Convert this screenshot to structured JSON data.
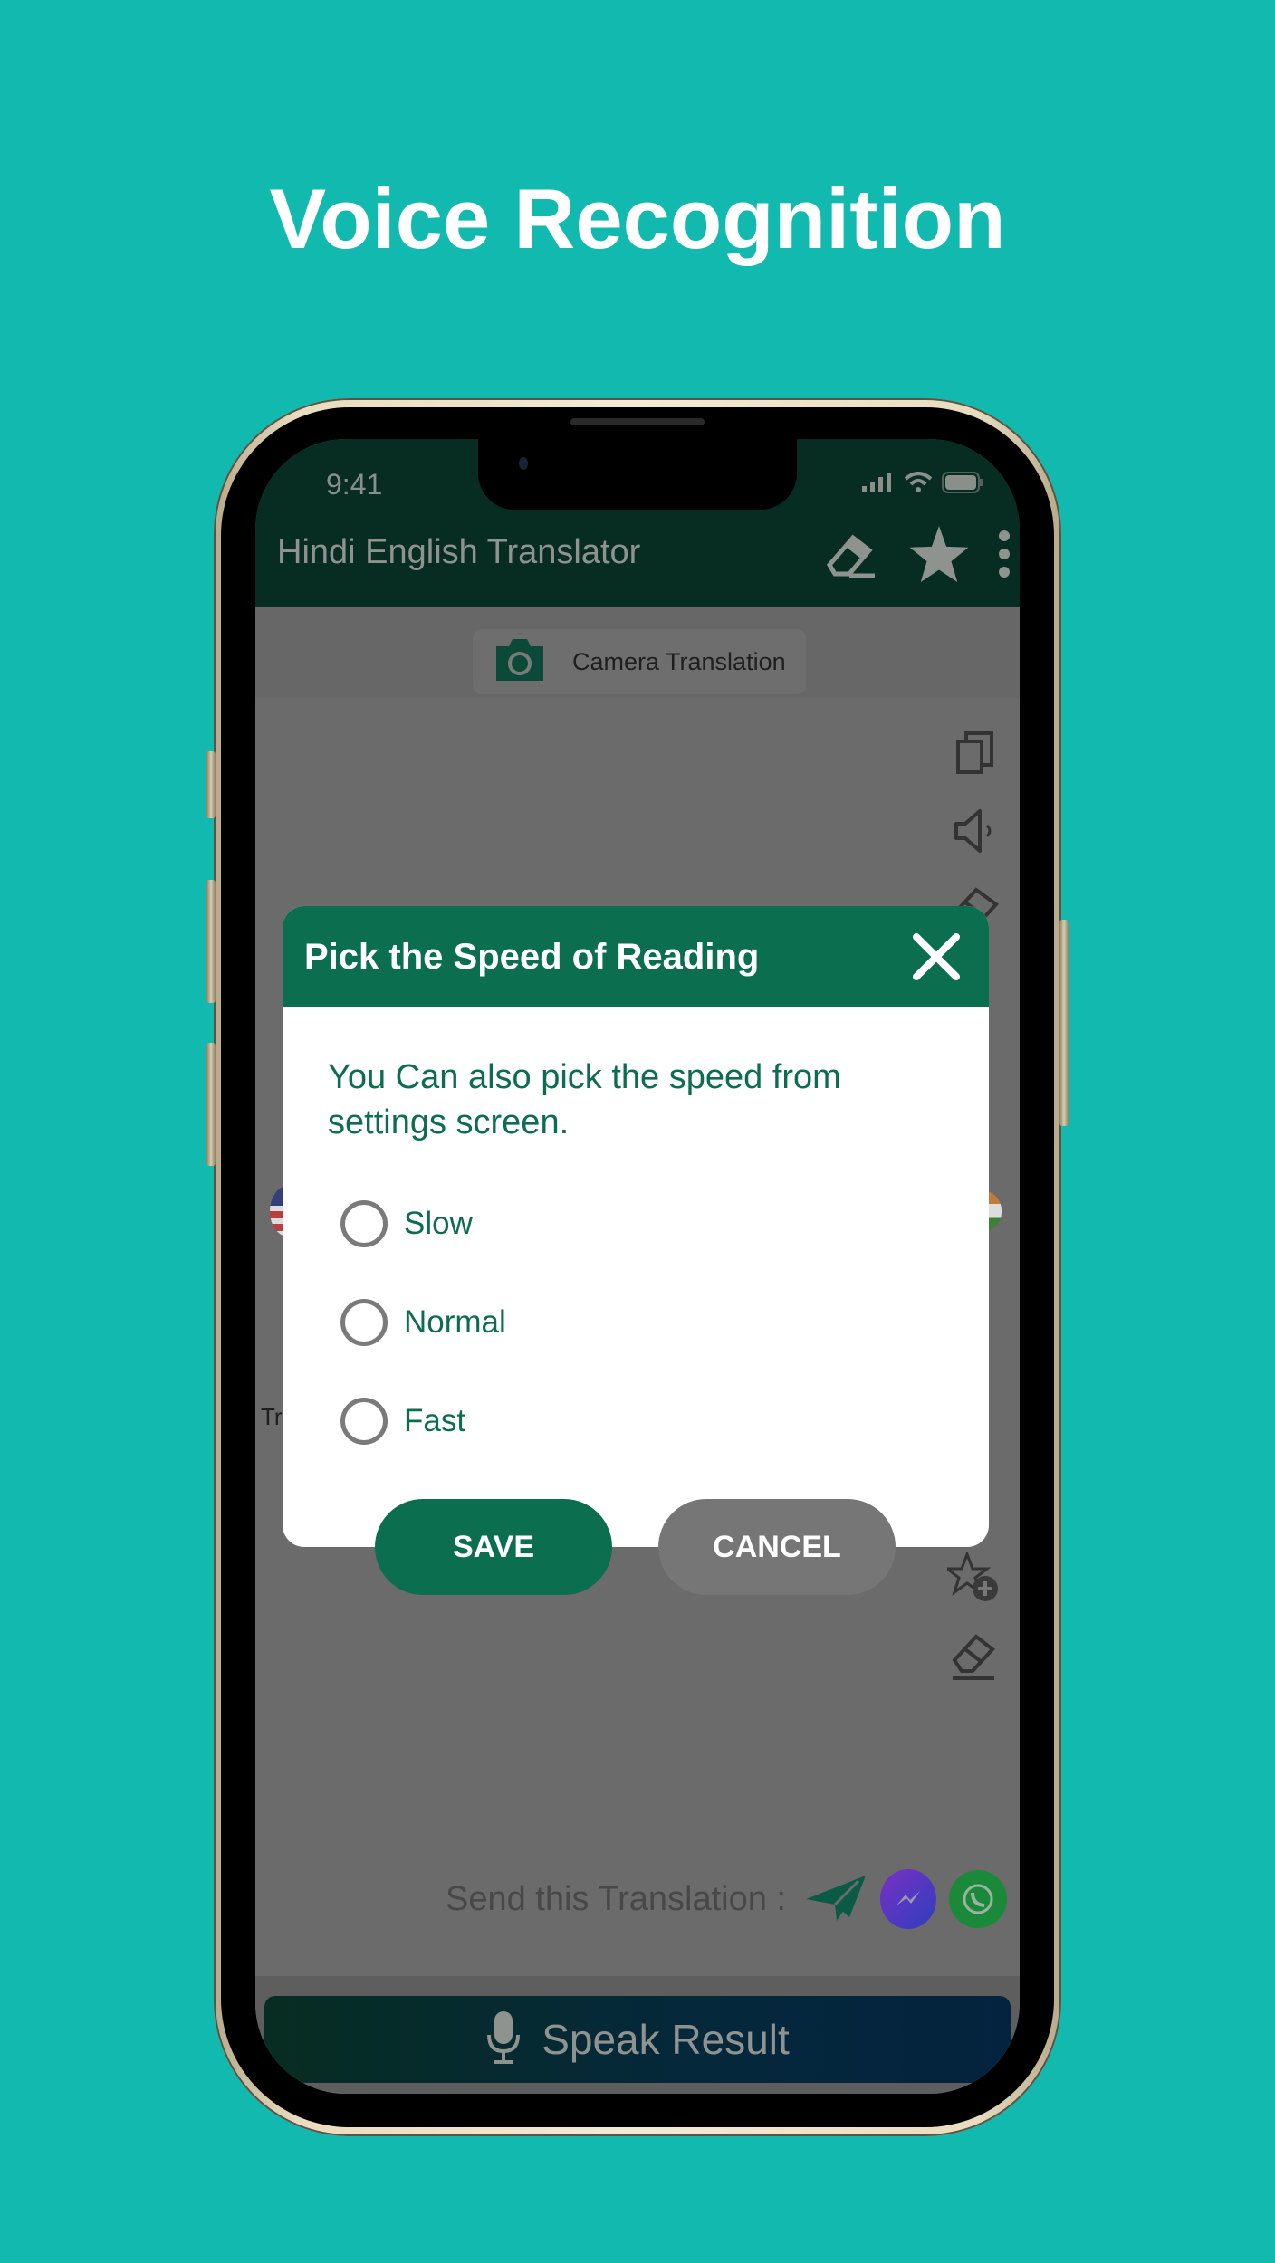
{
  "promo": {
    "title": "Voice Recognition"
  },
  "colors": {
    "background": "#12b9af",
    "accent_green": "#0b6e4f",
    "cancel_gray": "#767676",
    "dialog_text": "#0e6c50"
  },
  "status_bar": {
    "time": "9:41",
    "icons": [
      "signal-icon",
      "wifi-icon",
      "battery-icon"
    ]
  },
  "app_bar": {
    "title": "Hindi English Translator",
    "actions": [
      "eraser-icon",
      "star-icon",
      "more-vert-icon"
    ]
  },
  "camera_button": {
    "label": "Camera Translation",
    "icon": "camera-icon"
  },
  "input_tools": [
    "copy-icon",
    "speaker-icon",
    "eraser-icon"
  ],
  "output_tools": [
    "favorite-add-icon",
    "eraser-icon"
  ],
  "partial_text": {
    "left_label": "Tr"
  },
  "share": {
    "label": "Send this Translation :",
    "targets": [
      "telegram-icon",
      "messenger-icon",
      "whatsapp-icon"
    ]
  },
  "speak_button": {
    "label": "Speak Result",
    "icon": "microphone-icon"
  },
  "dialog": {
    "title": "Pick the Speed of Reading",
    "message": "You Can also pick the speed from settings screen.",
    "options": [
      {
        "label": "Slow",
        "selected": false
      },
      {
        "label": "Normal",
        "selected": false
      },
      {
        "label": "Fast",
        "selected": false
      }
    ],
    "save_label": "SAVE",
    "cancel_label": "CANCEL"
  }
}
